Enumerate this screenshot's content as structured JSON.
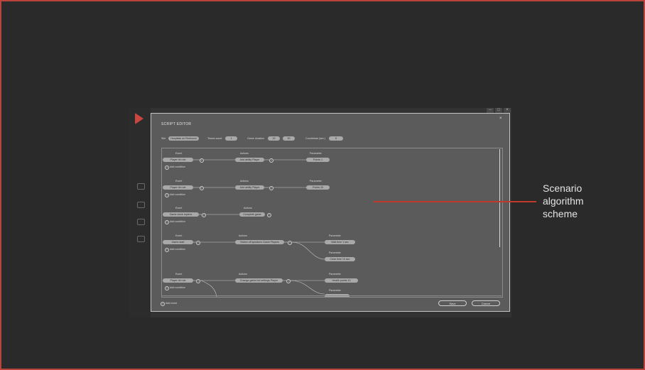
{
  "annotation": {
    "label": "Scenario algorithm scheme"
  },
  "window": {
    "minimize": "–",
    "maximize": "□",
    "close": "×"
  },
  "dialog": {
    "title": "SCRIPT EDITOR",
    "close": "×",
    "params": [
      {
        "label": "Site",
        "value": "Hospitals on Redmond"
      },
      {
        "label": "Teams count",
        "value": "1"
      },
      {
        "label": "Game duration",
        "value": "15",
        "value2": "30"
      },
      {
        "label": "Countdown (sec.)",
        "value": "5"
      }
    ],
    "add_condition": "Add condition",
    "add_event": "Add event",
    "save": "Save",
    "cancel": "Cancel"
  },
  "rules": [
    {
      "event_label": "Event",
      "event": "Player hit rule",
      "action_label": "Actions",
      "actions": [
        "Add ability Player"
      ],
      "param_label": "Parameter",
      "params": [
        "Points 1"
      ]
    },
    {
      "event_label": "Event",
      "event": "Player hit rule",
      "action_label": "Actions",
      "actions": [
        "Add ability Player"
      ],
      "param_label": "Parameter",
      "params": [
        "Points 10"
      ]
    },
    {
      "event_label": "Event",
      "event": "Game clock expires",
      "action_label": "Actions",
      "actions": [
        "Complete game"
      ],
      "param_label": "",
      "params": []
    },
    {
      "event_label": "Event",
      "event": "Game start",
      "action_label": "Actions",
      "actions": [
        "Switch off speakers Game Players"
      ],
      "param_label": "Parameter",
      "params": [
        "Wait time 1 sec",
        "Clear time 10 sec"
      ]
    },
    {
      "event_label": "Event",
      "event": "Player hit rule",
      "action_label": "Actions",
      "actions": [
        "Change game bot settings Player"
      ],
      "param_label": "Parameter",
      "params": [
        "Health points 10",
        ""
      ]
    }
  ]
}
